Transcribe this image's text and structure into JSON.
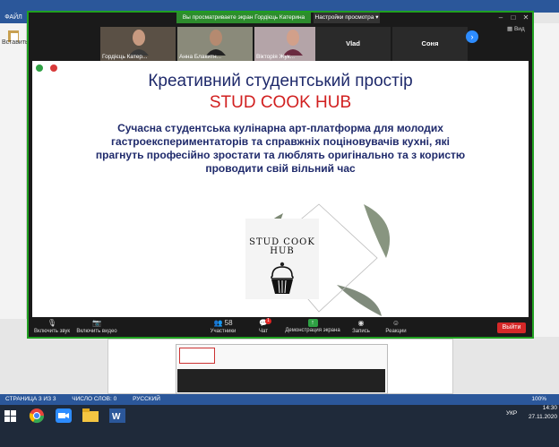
{
  "word": {
    "ribbon_tab": "ФАЙЛ",
    "paste_label": "Вставить",
    "status": {
      "page": "СТРАНИЦА 3 ИЗ 3",
      "words": "ЧИСЛО СЛОВ: 0",
      "language": "РУССКИЙ",
      "zoom": "100%"
    }
  },
  "taskbar": {
    "lang": "УКР",
    "time": "14:30",
    "date": "27.11.2020"
  },
  "zoom": {
    "share_banner": "Вы просматриваете экран Гордієць Катерина",
    "view_options": "Настройки просмотра",
    "view_label": "Вид",
    "participants": [
      {
        "name": "Гордієць Катер..."
      },
      {
        "name": "Анна Блакитн..."
      },
      {
        "name": "Вікторія Жук..."
      },
      {
        "name": "Vlad"
      },
      {
        "name": "Соня"
      }
    ],
    "slide": {
      "title": "Креативний студентський простір",
      "subtitle": "STUD COOK HUB",
      "description": "Сучасна студентська кулінарна арт-платформа для молодих гастроекспериментаторів та справжніх поціновувачів кухні, які прагнуть професійно зростати та люблять оригінально та з користю проводити свій вільний час",
      "logo_line1": "STUD COOK",
      "logo_line2": "HUB"
    },
    "toolbar": {
      "mute": "Включить звук",
      "video": "Включить видео",
      "participants": "Участники",
      "participants_count": "58",
      "chat": "Чат",
      "chat_badge": "1",
      "share": "Демонстрация экрана",
      "record": "Запись",
      "reactions": "Реакции",
      "leave": "Выйти"
    }
  },
  "colors": {
    "word_blue": "#2b579a",
    "share_green": "#2d8c2d",
    "slide_title": "#1f2a6b",
    "slide_red": "#d11f1f",
    "leave_red": "#d62828"
  }
}
